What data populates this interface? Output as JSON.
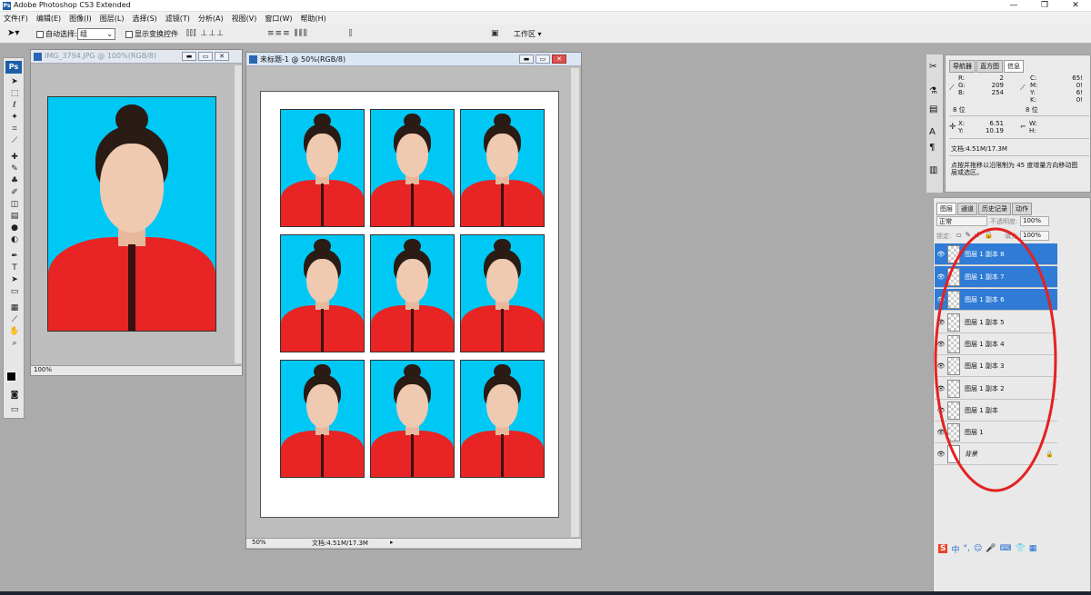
{
  "app": {
    "title": "Adobe Photoshop CS3 Extended"
  },
  "menu": [
    "文件(F)",
    "编辑(E)",
    "图像(I)",
    "图层(L)",
    "选择(S)",
    "滤镜(T)",
    "分析(A)",
    "视图(V)",
    "窗口(W)",
    "帮助(H)"
  ],
  "options": {
    "auto_select_label": "自动选择:",
    "auto_select_value": "组",
    "show_transform_label": "显示变换控件",
    "workspace_label": "工作区"
  },
  "doc1": {
    "title": "IMG_3794.JPG @ 100%(RGB/8)",
    "zoom": "100%"
  },
  "doc2": {
    "title": "未标题-1 @ 50%(RGB/8)",
    "zoom": "50%",
    "doc_info": "文档:4.51M/17.3M"
  },
  "info_panel": {
    "tabs": [
      "导航器",
      "直方图",
      "信息"
    ],
    "rgb": {
      "R": "2",
      "G": "209",
      "B": "254"
    },
    "cmyk": {
      "C": "65!",
      "M": "0!",
      "Y": "6!",
      "K": "0!"
    },
    "bits_left": "8 位",
    "bits_right": "8 位",
    "xy": {
      "X": "6.51",
      "Y": "10.19"
    },
    "wh": {
      "W": "",
      "H": ""
    },
    "doc_info": "文档:4.51M/17.3M",
    "hint": "点按并拖移以沿限制为 45 度增量方向移动图层或选区。"
  },
  "layers_panel": {
    "tabs": [
      "图层",
      "通道",
      "历史记录",
      "动作"
    ],
    "blend_mode": "正常",
    "opacity_label": "不透明度:",
    "opacity": "100%",
    "lock_label": "锁定:",
    "fill_label": "填充:",
    "fill": "100%",
    "layers": [
      {
        "name": "图层 1 副本 8",
        "selected": true
      },
      {
        "name": "图层 1 副本 7",
        "selected": true
      },
      {
        "name": "图层 1 副本 6",
        "selected": true
      },
      {
        "name": "图层 1 副本 5",
        "selected": false
      },
      {
        "name": "图层 1 副本 4",
        "selected": false
      },
      {
        "name": "图层 1 副本 3",
        "selected": false
      },
      {
        "name": "图层 1 副本 2",
        "selected": false
      },
      {
        "name": "图层 1 副本",
        "selected": false
      },
      {
        "name": "图层 1",
        "selected": false
      },
      {
        "name": "背景",
        "selected": false
      }
    ]
  },
  "ime_bar": {
    "label": "中"
  },
  "colors": {
    "photo_bg": "#00c8f5",
    "coat": "#e82524",
    "selection": "#2f7bd6",
    "annotation": "#e32222"
  }
}
